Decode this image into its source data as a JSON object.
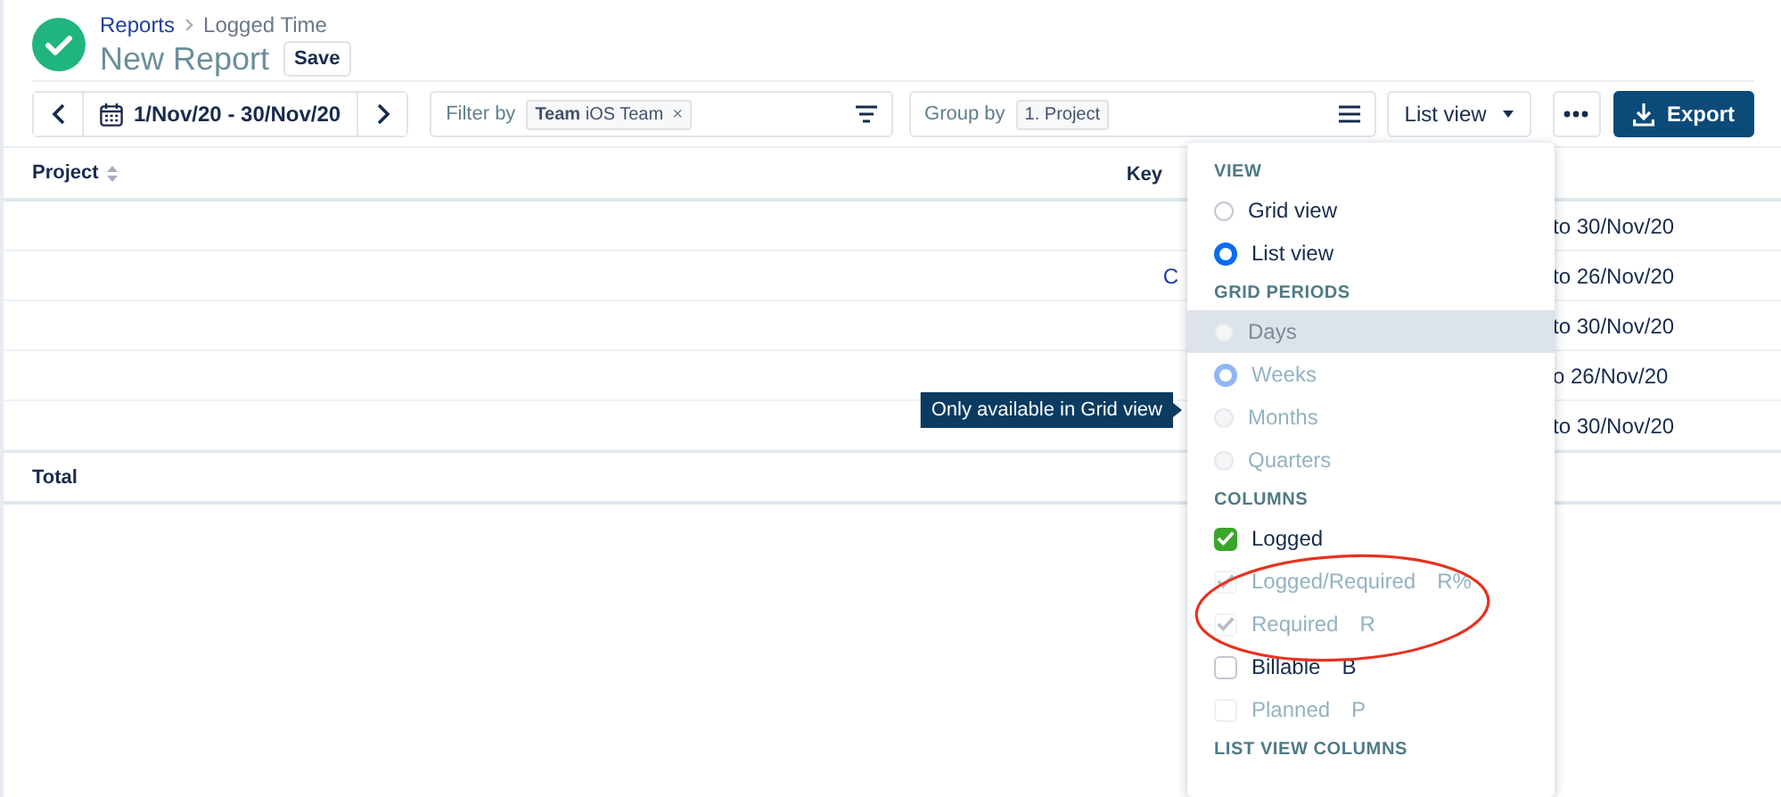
{
  "header": {
    "breadcrumb": [
      {
        "label": "Reports",
        "kind": "link"
      },
      {
        "label": "Logged Time",
        "kind": "current"
      }
    ],
    "title": "New Report",
    "save_button": "Save"
  },
  "toolbar": {
    "date_range": "1/Nov/20 - 30/Nov/20",
    "filter": {
      "label": "Filter by",
      "chips": [
        {
          "text": "**Team** iOS Team",
          "remove": "×"
        }
      ]
    },
    "group": {
      "label": "Group by",
      "chips": [
        {
          "text": "1. Project"
        }
      ]
    },
    "view_button": "List view",
    "export_button": "Export"
  },
  "table": {
    "columns": [
      "Project",
      "Key"
    ],
    "rows": [
      {
        "date": "to 30/Nov/20"
      },
      {
        "key": "C",
        "date": "to 26/Nov/20"
      },
      {
        "date": "to 30/Nov/20"
      },
      {
        "date": "o 26/Nov/20"
      },
      {
        "date": "to 30/Nov/20"
      }
    ],
    "total": "Total"
  },
  "tooltip": "Only available in Grid view",
  "dropdown": {
    "sections": [
      {
        "title": "VIEW",
        "items": [
          {
            "kind": "radio",
            "label": "Grid view",
            "selected": false,
            "disabled": false,
            "highlighted": false
          },
          {
            "kind": "radio",
            "label": "List view",
            "selected": true,
            "disabled": false,
            "highlighted": false
          }
        ]
      },
      {
        "title": "GRID PERIODS",
        "items": [
          {
            "kind": "radio",
            "label": "Days",
            "selected": false,
            "disabled": true,
            "highlighted": true
          },
          {
            "kind": "radio",
            "label": "Weeks",
            "selected": true,
            "disabled": true,
            "highlighted": false
          },
          {
            "kind": "radio",
            "label": "Months",
            "selected": false,
            "disabled": true,
            "highlighted": false
          },
          {
            "kind": "radio",
            "label": "Quarters",
            "selected": false,
            "disabled": true,
            "highlighted": false
          }
        ]
      },
      {
        "title": "COLUMNS",
        "items": [
          {
            "kind": "checkbox",
            "label": "Logged",
            "checked": true,
            "disabled": false
          },
          {
            "kind": "checkbox",
            "label": "Logged/Required",
            "shortcut": "R%",
            "checked": true,
            "disabled": true
          },
          {
            "kind": "checkbox",
            "label": "Required",
            "shortcut": "R",
            "checked": true,
            "disabled": true
          },
          {
            "kind": "checkbox",
            "label": "Billable",
            "shortcut": "B",
            "checked": false,
            "disabled": false
          },
          {
            "kind": "checkbox",
            "label": "Planned",
            "shortcut": "P",
            "checked": false,
            "disabled": true
          }
        ]
      },
      {
        "title": "LIST VIEW COLUMNS"
      }
    ]
  }
}
